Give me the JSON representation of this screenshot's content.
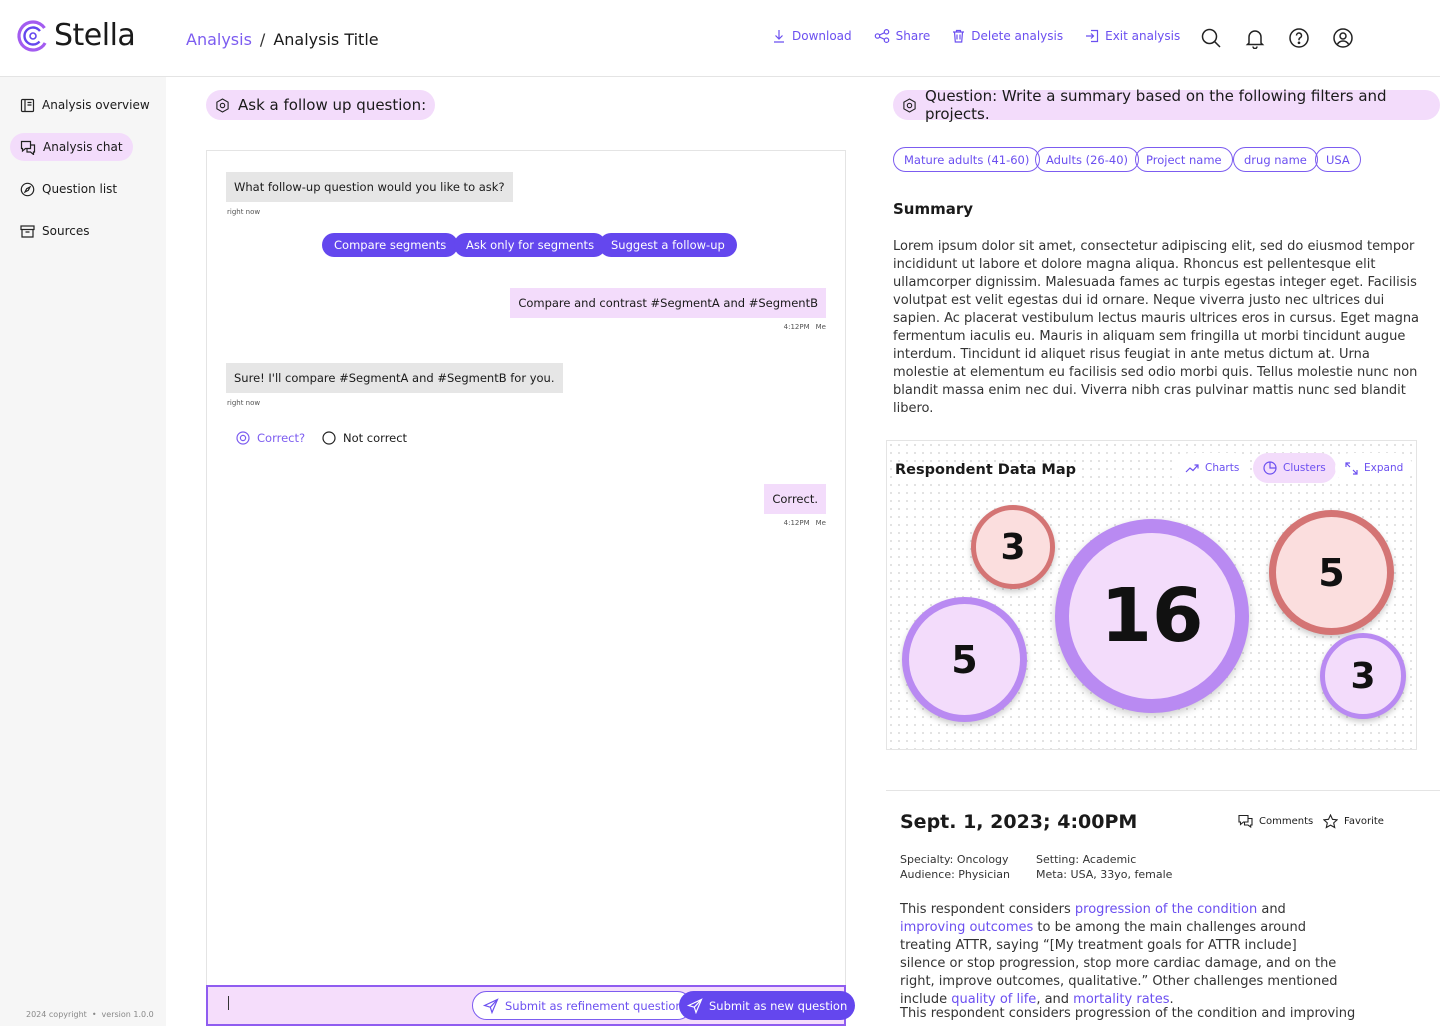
{
  "header": {
    "brand": "Stella",
    "breadcrumb": {
      "parent": "Analysis",
      "separator": "/",
      "current": "Analysis Title"
    },
    "actions": {
      "download": "Download",
      "share": "Share",
      "delete": "Delete analysis",
      "exit": "Exit analysis"
    },
    "icons": [
      "search-icon",
      "bell-icon",
      "help-icon",
      "user-icon"
    ]
  },
  "sidebar": {
    "items": [
      {
        "label": "Analysis overview",
        "icon": "book-icon"
      },
      {
        "label": "Analysis chat",
        "icon": "chat-icon",
        "active": true
      },
      {
        "label": "Question list",
        "icon": "compass-icon"
      },
      {
        "label": "Sources",
        "icon": "archive-icon"
      }
    ],
    "footer": {
      "copyright": "2024 copyright",
      "dot": "•",
      "version": "version 1.0.0"
    }
  },
  "chat": {
    "heading": "Ask a follow up question:",
    "messages": {
      "bot1": {
        "text": "What follow-up question would you like to ask?",
        "time": "right now"
      },
      "me1": {
        "text": "Compare and contrast #SegmentA and #SegmentB",
        "time": "4:12PM",
        "sender": "Me"
      },
      "bot2": {
        "text": "Sure! I'll compare #SegmentA and #SegmentB for you.",
        "time": "right now"
      },
      "me2": {
        "text": "Correct.",
        "time": "4:12PM",
        "sender": "Me"
      }
    },
    "suggestions": [
      "Compare segments",
      "Ask only for segments",
      "Suggest a follow-up"
    ],
    "feedback": {
      "correct": "Correct?",
      "not_correct": "Not correct",
      "selected": "correct"
    },
    "input": {
      "value": ""
    },
    "submit_refinement": "Submit as refinement question",
    "submit_new": "Submit as new question"
  },
  "question": {
    "heading": "Question: Write a summary based on the following filters and projects.",
    "tags": [
      "Mature adults (41-60)",
      "Adults (26-40)",
      "Project name",
      "drug name",
      "USA"
    ],
    "summary_title": "Summary",
    "summary_text": "Lorem ipsum dolor sit amet, consectetur adipiscing elit, sed do eiusmod tempor incididunt ut labore et dolore magna aliqua. Rhoncus est pellentesque elit ullamcorper dignissim. Malesuada fames ac turpis egestas integer eget. Facilisis volutpat est velit egestas dui id ornare. Neque viverra justo nec ultrices dui sapien. Ac placerat vestibulum lectus mauris ultrices eros in cursus. Eget magna fermentum iaculis eu. Mauris in aliquam sem fringilla ut morbi tincidunt augue interdum. Tincidunt id aliquet risus feugiat in ante metus dictum at. Urna molestie at elementum eu facilisis sed odio morbi quis. Tellus molestie nunc non blandit massa enim nec dui. Viverra nibh cras pulvinar mattis nunc sed blandit libero."
  },
  "data_map": {
    "title": "Respondent Data Map",
    "tabs": {
      "charts": "Charts",
      "clusters": "Clusters",
      "expand": "Expand"
    },
    "active_tab": "clusters",
    "clusters": [
      {
        "count": "3",
        "color": "#d47474"
      },
      {
        "count": "5",
        "color": "#b98af2"
      },
      {
        "count": "16",
        "color": "#b98af2"
      },
      {
        "count": "5",
        "color": "#d47474"
      },
      {
        "count": "3",
        "color": "#b98af2"
      }
    ]
  },
  "respondent": {
    "date": "Sept. 1, 2023; 4:00PM",
    "comments": "Comments",
    "favorite": "Favorite",
    "specialty": "Specialty: Oncology",
    "audience": "Audience: Physician",
    "setting": "Setting: Academic",
    "meta": "Meta: USA, 33yo, female",
    "text": {
      "p1": "This respondent considers ",
      "h1": "progression of the condition",
      "p2": " and ",
      "h2": "improving outcomes",
      "p3": " to be among the main challenges around treating ATTR, saying “[My treatment goals for ATTR include] silence or stop progression, stop more cardiac damage, and on the right, improve outcomes, qualitative.” Other challenges mentioned include ",
      "h3": "quality of life",
      "p4": ", and ",
      "h4": "mortality rates",
      "p5": "."
    },
    "text2": "This respondent considers progression of the condition and improving"
  },
  "colors": {
    "accent": "#6447ee",
    "accent_text": "#6b4ff0",
    "pill_bg": "#f3dcfb",
    "chat_bot_bg": "#e6e6e6",
    "cluster_red": "#d47474",
    "cluster_purple": "#b98af2"
  }
}
